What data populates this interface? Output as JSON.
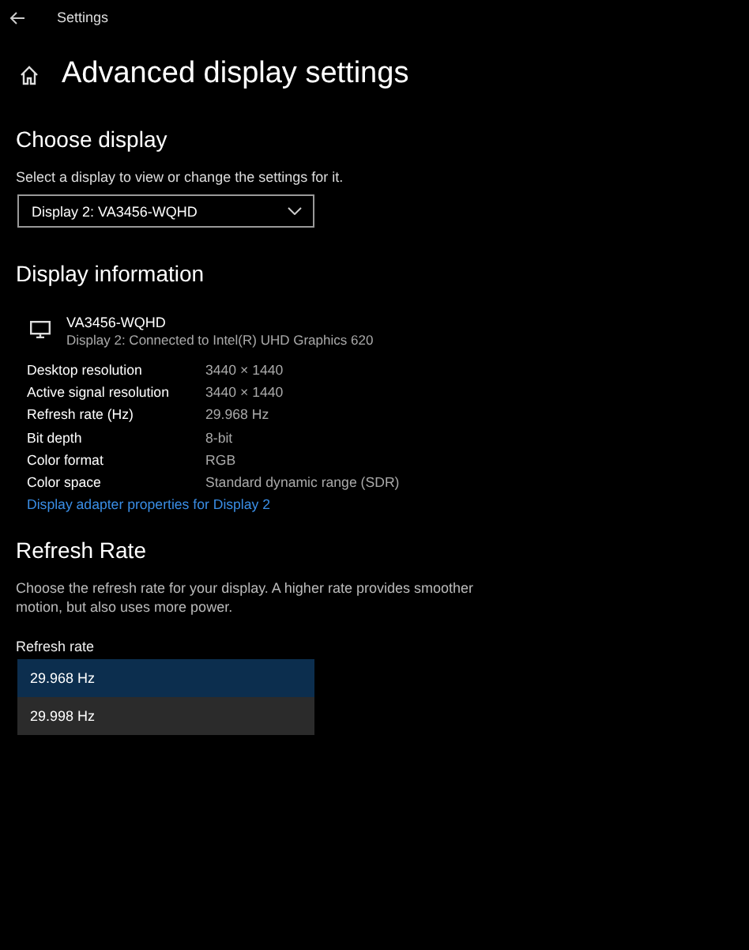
{
  "window": {
    "title": "Settings"
  },
  "page": {
    "title": "Advanced display settings"
  },
  "choose_display": {
    "heading": "Choose display",
    "description": "Select a display to view or change the settings for it.",
    "dropdown": {
      "value": "Display 2: VA3456-WQHD"
    }
  },
  "display_information": {
    "heading": "Display information",
    "monitor_name": "VA3456-WQHD",
    "connection": "Display 2: Connected to Intel(R) UHD Graphics 620",
    "rows": [
      {
        "label": "Desktop resolution",
        "value": "3440 × 1440"
      },
      {
        "label": "Active signal resolution",
        "value": "3440 × 1440"
      },
      {
        "label": "Refresh rate (Hz)",
        "value": "29.968 Hz"
      },
      {
        "label": "Bit depth",
        "value": "8-bit"
      },
      {
        "label": "Color format",
        "value": "RGB"
      },
      {
        "label": "Color space",
        "value": "Standard dynamic range (SDR)"
      }
    ],
    "link": "Display adapter properties for Display 2"
  },
  "refresh_rate": {
    "heading": "Refresh Rate",
    "description": "Choose the refresh rate for your display. A higher rate provides smoother motion, but also uses more power.",
    "label": "Refresh rate",
    "options": [
      {
        "label": "29.968 Hz",
        "selected": true
      },
      {
        "label": "29.998 Hz",
        "selected": false
      }
    ]
  }
}
